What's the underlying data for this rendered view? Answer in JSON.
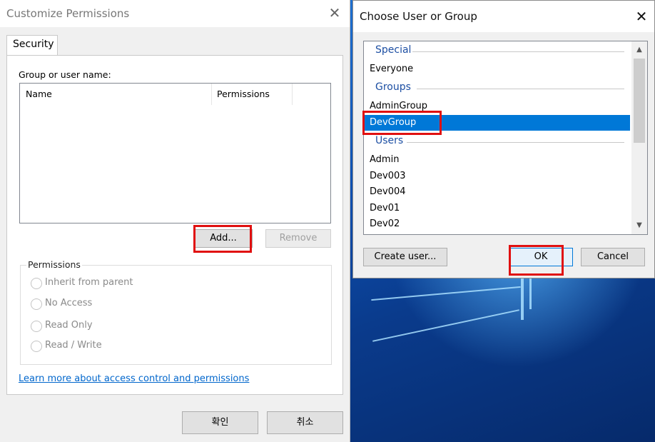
{
  "left_dialog": {
    "title": "Customize Permissions",
    "tab_label": "Security",
    "group_label": "Group or user name:",
    "columns": [
      "Name",
      "Permissions"
    ],
    "add_label": "Add...",
    "remove_label": "Remove",
    "permissions_title": "Permissions",
    "permission_options": [
      "Inherit from parent",
      "No Access",
      "Read Only",
      "Read / Write"
    ],
    "learn_more": "Learn more about access control and permissions",
    "confirm_label": "확인",
    "cancel_label": "취소"
  },
  "right_dialog": {
    "title": "Choose User or Group",
    "sections": {
      "special": "Special",
      "groups": "Groups",
      "users": "Users"
    },
    "items": {
      "everyone": "Everyone",
      "admingroup": "AdminGroup",
      "devgroup": "DevGroup",
      "admin": "Admin",
      "dev003": "Dev003",
      "dev004": "Dev004",
      "dev01": "Dev01",
      "dev02": "Dev02"
    },
    "selected_item": "DevGroup",
    "create_user_label": "Create user...",
    "ok_label": "OK",
    "cancel_label": "Cancel"
  },
  "colors": {
    "selection": "#0078d7",
    "highlight_box": "#e01010",
    "link": "#0066cc"
  }
}
